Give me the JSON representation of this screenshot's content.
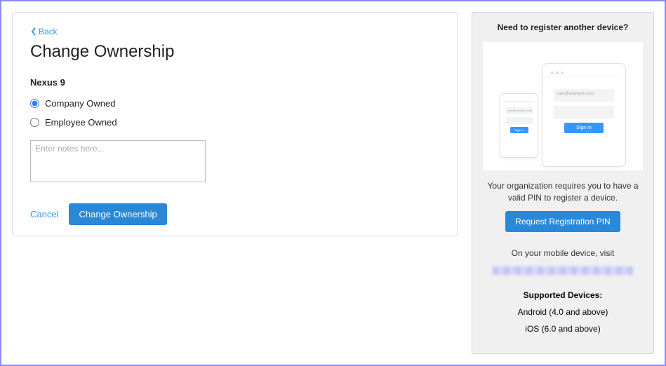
{
  "main": {
    "back": "Back",
    "title": "Change Ownership",
    "device": "Nexus 9",
    "ownership": {
      "company": "Company Owned",
      "employee": "Employee Owned",
      "selected": "company"
    },
    "notes_placeholder": "Enter notes here...",
    "cancel": "Cancel",
    "submit": "Change Ownership"
  },
  "side": {
    "title": "Need to register another device?",
    "illustration": {
      "username_hint": "user@example.com",
      "signin": "Sign In"
    },
    "pin_text": "Your organization requires you to have a valid PIN to register a device.",
    "pin_button": "Request Registration PIN",
    "visit_text": "On your mobile device, visit",
    "supported_title": "Supported Devices:",
    "supported": [
      "Android (4.0 and above)",
      "iOS (6.0 and above)"
    ]
  }
}
